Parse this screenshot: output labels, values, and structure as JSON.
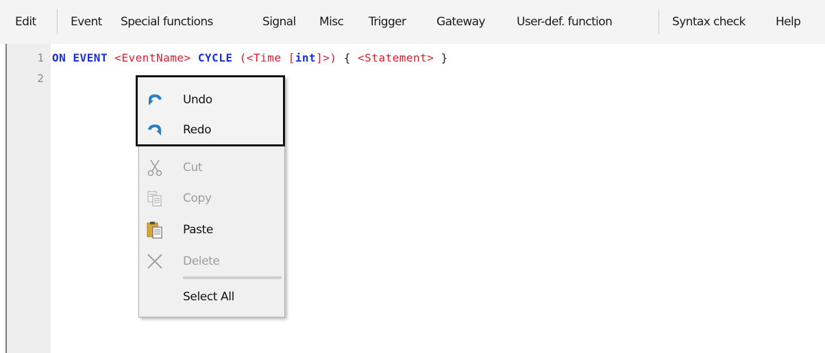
{
  "menubar": {
    "edit": "Edit",
    "event": "Event",
    "special_functions": "Special functions",
    "signal": "Signal",
    "misc": "Misc",
    "trigger": "Trigger",
    "gateway": "Gateway",
    "user_def_function": "User-def. function",
    "syntax_check": "Syntax check",
    "help": "Help"
  },
  "editor": {
    "line_numbers": [
      "1",
      "2"
    ],
    "line1": {
      "on": "ON",
      "event": "EVENT",
      "event_name": "<EventName>",
      "cycle": "CYCLE",
      "open_paren": "(",
      "time_open": "<Time",
      "bracket_open": "[",
      "int": "int",
      "bracket_close": "]>",
      "close_paren": ")",
      "brace_open": "{",
      "statement": "<Statement>",
      "brace_close": "}"
    }
  },
  "context_menu": {
    "undo": "Undo",
    "redo": "Redo",
    "cut": "Cut",
    "copy": "Copy",
    "paste": "Paste",
    "delete": "Delete",
    "select_all": "Select All"
  },
  "colors": {
    "keyword": "#1c2fd8",
    "placeholder": "#e0192d",
    "disabled_text": "#9c9c9c",
    "undo_redo_icon": "#2a7fc4"
  }
}
